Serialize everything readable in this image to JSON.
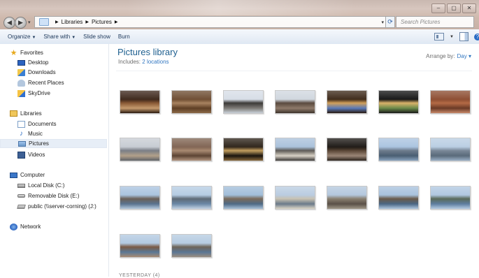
{
  "window": {
    "back_symbol": "◀",
    "forward_symbol": "▶",
    "controls": [
      "–",
      "▢",
      "✕"
    ]
  },
  "address": {
    "breadcrumb": [
      "Libraries",
      "Pictures"
    ],
    "search_placeholder": "Search Pictures"
  },
  "toolbar": {
    "organize": "Organize",
    "share_with": "Share with",
    "slide_show": "Slide show",
    "burn": "Burn"
  },
  "sidebar": {
    "favorites": {
      "label": "Favorites",
      "items": [
        "Desktop",
        "Downloads",
        "Recent Places",
        "SkyDrive"
      ]
    },
    "libraries": {
      "label": "Libraries",
      "items": [
        "Documents",
        "Music",
        "Pictures",
        "Videos"
      ]
    },
    "computer": {
      "label": "Computer",
      "items": [
        "Local Disk (C:)",
        "Removable Disk (E:)",
        "public (\\\\server-corning) (J:)"
      ]
    },
    "network": {
      "label": "Network"
    },
    "selected": "Pictures"
  },
  "main": {
    "title": "Pictures library",
    "includes_label": "Includes:",
    "includes_link": "2 locations",
    "arrange_label": "Arrange by:",
    "arrange_value": "Day",
    "group_footer": "YESTERDAY (4)",
    "photos": [
      {
        "name": "photo-painting",
        "colors": [
          "#3a2418",
          "#8a5a36",
          "#c59a6e",
          "#2a1a10"
        ]
      },
      {
        "name": "photo-carved-panel",
        "colors": [
          "#6b4a2f",
          "#a88360",
          "#5e3f25",
          "#8c6a49"
        ]
      },
      {
        "name": "photo-tower",
        "colors": [
          "#d6dde6",
          "#3c3a38",
          "#7e7b77",
          "#c9d0d9"
        ]
      },
      {
        "name": "photo-gothic-building",
        "colors": [
          "#cfd6de",
          "#5a4a3e",
          "#8e7a6a",
          "#3e342c"
        ]
      },
      {
        "name": "photo-arched-window",
        "colors": [
          "#3a2616",
          "#d2a05a",
          "#5a7ab8",
          "#2a1a10"
        ]
      },
      {
        "name": "photo-stained-glass",
        "colors": [
          "#111111",
          "#d9b36a",
          "#6a8a4a",
          "#181818"
        ]
      },
      {
        "name": "photo-brick-facade",
        "colors": [
          "#8a4a2e",
          "#b46a46",
          "#6a3a26",
          "#c88a6a"
        ]
      },
      {
        "name": "photo-downtown-street",
        "colors": [
          "#c6cbd2",
          "#7a7e86",
          "#b2a08a",
          "#5e6268"
        ]
      },
      {
        "name": "photo-stone-relief",
        "colors": [
          "#7e6250",
          "#a88a72",
          "#5c4434",
          "#b29680"
        ]
      },
      {
        "name": "photo-plaque",
        "colors": [
          "#2a2016",
          "#c4a060",
          "#1a140e",
          "#8a6a3e"
        ]
      },
      {
        "name": "photo-street-view",
        "colors": [
          "#a8c0da",
          "#5e5a56",
          "#d8d2c6",
          "#3a3836"
        ]
      },
      {
        "name": "photo-dark-interior",
        "colors": [
          "#1a1612",
          "#5a4636",
          "#9a8676",
          "#2a221c"
        ]
      },
      {
        "name": "photo-harbor-skyline",
        "colors": [
          "#a9c3df",
          "#6e7c8c",
          "#4a5e72",
          "#8aa4be"
        ]
      },
      {
        "name": "photo-ship",
        "colors": [
          "#b8cde2",
          "#7a8898",
          "#5a6a7a",
          "#9ab0c6"
        ]
      },
      {
        "name": "photo-river-shore",
        "colors": [
          "#a8c2de",
          "#6a6058",
          "#5a7490",
          "#b4c8dc"
        ]
      },
      {
        "name": "photo-river-bridge",
        "colors": [
          "#b4cbe2",
          "#5e6a76",
          "#6a88a6",
          "#c2d2e2"
        ]
      },
      {
        "name": "photo-waterfront-town",
        "colors": [
          "#9fbcd8",
          "#7a6a5a",
          "#4e6a86",
          "#a8c0d8"
        ]
      },
      {
        "name": "photo-railing-view",
        "colors": [
          "#b8cbe0",
          "#c9c2b2",
          "#6a7a8a",
          "#dcd6c6"
        ]
      },
      {
        "name": "photo-grain-elevator",
        "colors": [
          "#b2c6dc",
          "#8a8070",
          "#5a5048",
          "#a09888"
        ]
      },
      {
        "name": "photo-industrial-shore",
        "colors": [
          "#a6c0dc",
          "#6a5a4a",
          "#4a6684",
          "#b0c6de"
        ]
      },
      {
        "name": "photo-lakefront",
        "colors": [
          "#aec6e0",
          "#5a6a5a",
          "#5e7ea0",
          "#b6cce2"
        ]
      },
      {
        "name": "photo-brick-ruin",
        "colors": [
          "#b0c8e0",
          "#7a5a44",
          "#5a7896",
          "#a88a72"
        ]
      },
      {
        "name": "photo-silos",
        "colors": [
          "#b4cae0",
          "#6e6458",
          "#5a7694",
          "#9a8e80"
        ]
      }
    ]
  }
}
